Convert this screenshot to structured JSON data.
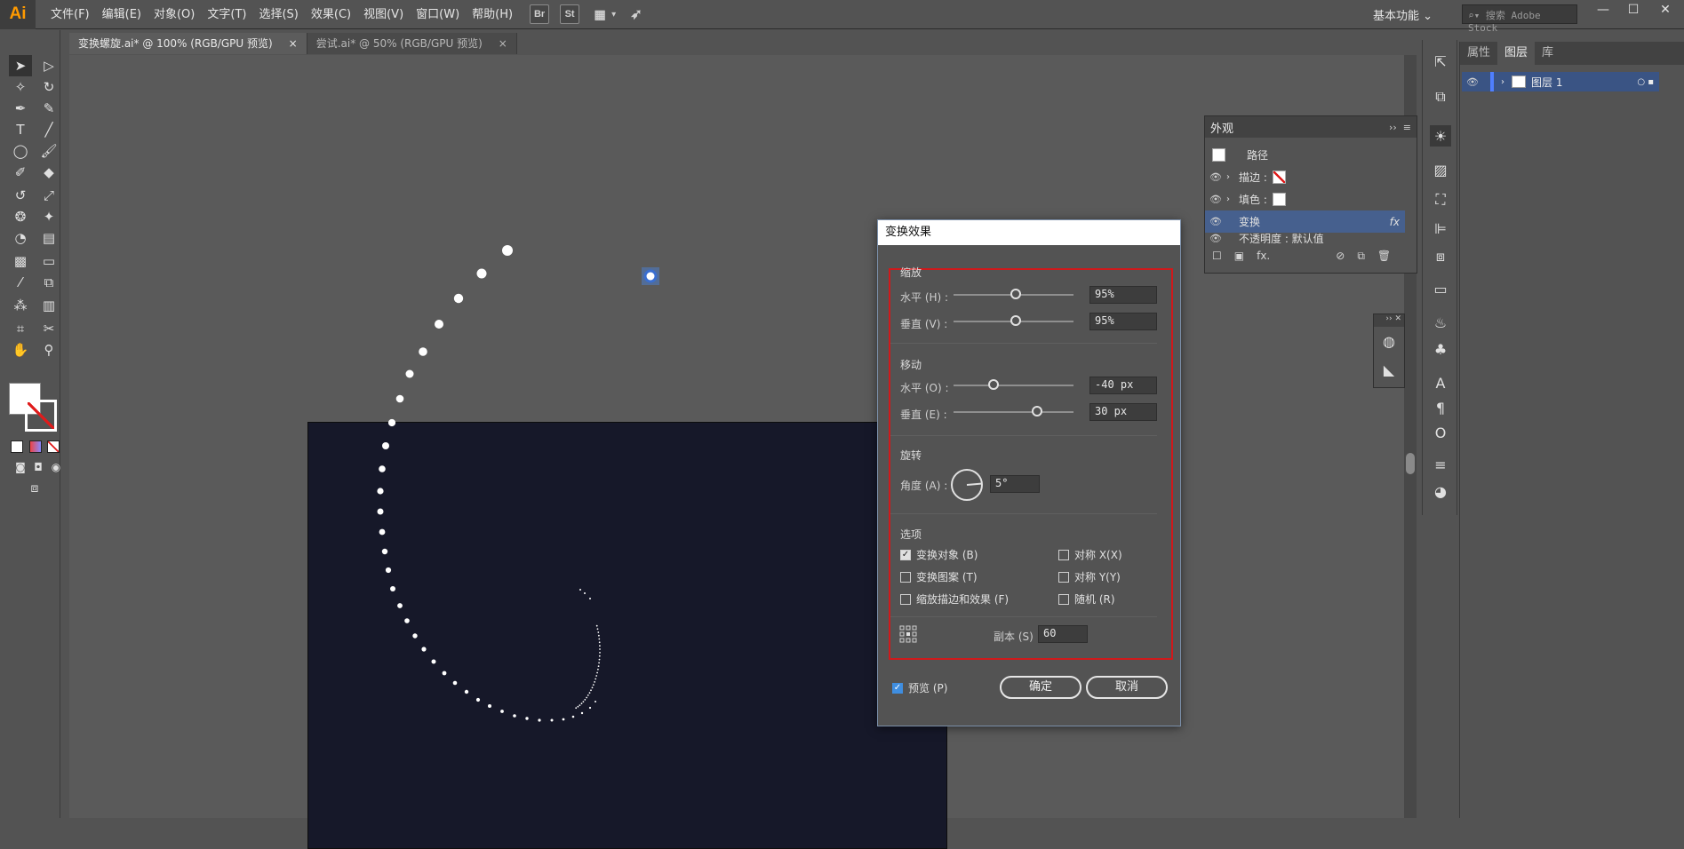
{
  "app": {
    "logo": "Ai",
    "menu": [
      "文件(F)",
      "编辑(E)",
      "对象(O)",
      "文字(T)",
      "选择(S)",
      "效果(C)",
      "视图(V)",
      "窗口(W)",
      "帮助(H)"
    ],
    "app_icons": [
      "Br",
      "St"
    ],
    "workspace": "基本功能",
    "stock_search_placeholder": "搜索 Adobe Stock"
  },
  "tabs": [
    {
      "label": "变换螺旋.ai* @ 100% (RGB/GPU 预览)",
      "close": "×"
    },
    {
      "label": "尝试.ai* @ 50% (RGB/GPU 预览)",
      "close": "×"
    }
  ],
  "layers_panel": {
    "tabs": [
      "属性",
      "图层",
      "库"
    ],
    "layer_name": "图层 1"
  },
  "appearance_panel": {
    "title": "外观",
    "rows": {
      "path": "路径",
      "stroke": "描边 :",
      "fill": "填色 :",
      "transform": "变换",
      "fx": "fx",
      "opacity": "不透明度 : 默认值"
    }
  },
  "dialog": {
    "title": "变换效果",
    "scale_section": "缩放",
    "scale_h_label": "水平 (H) :",
    "scale_h_value": "95%",
    "scale_v_label": "垂直 (V) :",
    "scale_v_value": "95%",
    "move_section": "移动",
    "move_h_label": "水平 (O) :",
    "move_h_value": "-40 px",
    "move_v_label": "垂直 (E) :",
    "move_v_value": "30 px",
    "rotate_section": "旋转",
    "angle_label": "角度 (A) :",
    "angle_value": "5°",
    "options_section": "选项",
    "opt_transform_objects": "变换对象 (B)",
    "opt_transform_patterns": "变换图案 (T)",
    "opt_scale_strokes": "缩放描边和效果 (F)",
    "opt_reflect_x": "对称 X(X)",
    "opt_reflect_y": "对称 Y(Y)",
    "opt_random": "随机 (R)",
    "copies_label": "副本 (S)",
    "copies_value": "60",
    "preview_label": "预览 (P)",
    "ok_label": "确定",
    "cancel_label": "取消"
  },
  "colors": {
    "artboard": "#161829",
    "highlight": "#d0191b",
    "selection": "#46608e"
  }
}
